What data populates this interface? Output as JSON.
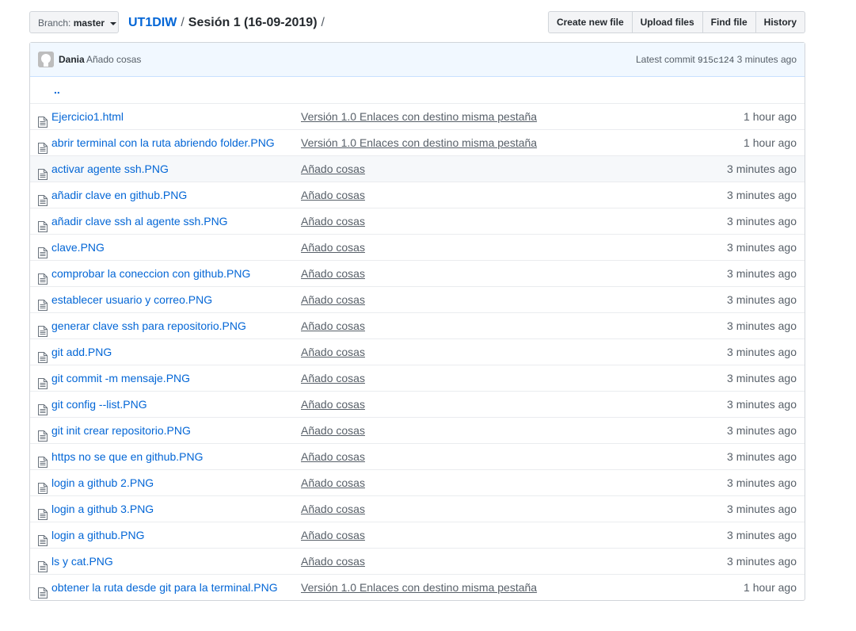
{
  "branch": {
    "label": "Branch:",
    "name": "master"
  },
  "breadcrumb": {
    "repo": "UT1DIW",
    "sep1": "/",
    "folder": "Sesión 1 (16-09-2019)",
    "sep2": "/"
  },
  "actions": {
    "create_new_file": "Create new file",
    "upload_files": "Upload files",
    "find_file": "Find file",
    "history": "History"
  },
  "commit": {
    "author": "Dania",
    "message": "Añado cosas",
    "latest_label": "Latest commit",
    "sha": "915c124",
    "age": "3 minutes ago"
  },
  "parent_link": "..",
  "files": [
    {
      "name": "Ejercicio1.html",
      "message": "Versión 1.0 Enlaces con destino misma pestaña",
      "age": "1 hour ago",
      "icon": "file-icon"
    },
    {
      "name": "abrir terminal con la ruta abriendo folder.PNG",
      "message": "Versión 1.0 Enlaces con destino misma pestaña",
      "age": "1 hour ago",
      "icon": "file-icon"
    },
    {
      "name": "activar agente ssh.PNG",
      "message": "Añado cosas",
      "age": "3 minutes ago",
      "icon": "file-icon"
    },
    {
      "name": "añadir clave en github.PNG",
      "message": "Añado cosas",
      "age": "3 minutes ago",
      "icon": "file-icon"
    },
    {
      "name": "añadir clave ssh al agente ssh.PNG",
      "message": "Añado cosas",
      "age": "3 minutes ago",
      "icon": "file-icon"
    },
    {
      "name": "clave.PNG",
      "message": "Añado cosas",
      "age": "3 minutes ago",
      "icon": "file-icon"
    },
    {
      "name": "comprobar la coneccion con github.PNG",
      "message": "Añado cosas",
      "age": "3 minutes ago",
      "icon": "file-icon"
    },
    {
      "name": "establecer usuario y correo.PNG",
      "message": "Añado cosas",
      "age": "3 minutes ago",
      "icon": "file-icon"
    },
    {
      "name": "generar clave ssh para repositorio.PNG",
      "message": "Añado cosas",
      "age": "3 minutes ago",
      "icon": "file-icon"
    },
    {
      "name": "git add.PNG",
      "message": "Añado cosas",
      "age": "3 minutes ago",
      "icon": "file-icon"
    },
    {
      "name": "git commit -m mensaje.PNG",
      "message": "Añado cosas",
      "age": "3 minutes ago",
      "icon": "file-icon"
    },
    {
      "name": "git config --list.PNG",
      "message": "Añado cosas",
      "age": "3 minutes ago",
      "icon": "file-icon"
    },
    {
      "name": "git init crear repositorio.PNG",
      "message": "Añado cosas",
      "age": "3 minutes ago",
      "icon": "file-icon"
    },
    {
      "name": "https no se que en github.PNG",
      "message": "Añado cosas",
      "age": "3 minutes ago",
      "icon": "file-icon"
    },
    {
      "name": "login a github 2.PNG",
      "message": "Añado cosas",
      "age": "3 minutes ago",
      "icon": "file-icon"
    },
    {
      "name": "login a github 3.PNG",
      "message": "Añado cosas",
      "age": "3 minutes ago",
      "icon": "file-icon"
    },
    {
      "name": "login a github.PNG",
      "message": "Añado cosas",
      "age": "3 minutes ago",
      "icon": "file-icon"
    },
    {
      "name": "ls y cat.PNG",
      "message": "Añado cosas",
      "age": "3 minutes ago",
      "icon": "file-icon"
    },
    {
      "name": "obtener la ruta desde git para la terminal.PNG",
      "message": "Versión 1.0 Enlaces con destino misma pestaña",
      "age": "1 hour ago",
      "icon": "file-icon"
    }
  ],
  "highlighted_row": 2,
  "colors": {
    "link": "#0366d6",
    "commit_bar_bg": "#f1f8ff",
    "border": "#d1d5da"
  }
}
